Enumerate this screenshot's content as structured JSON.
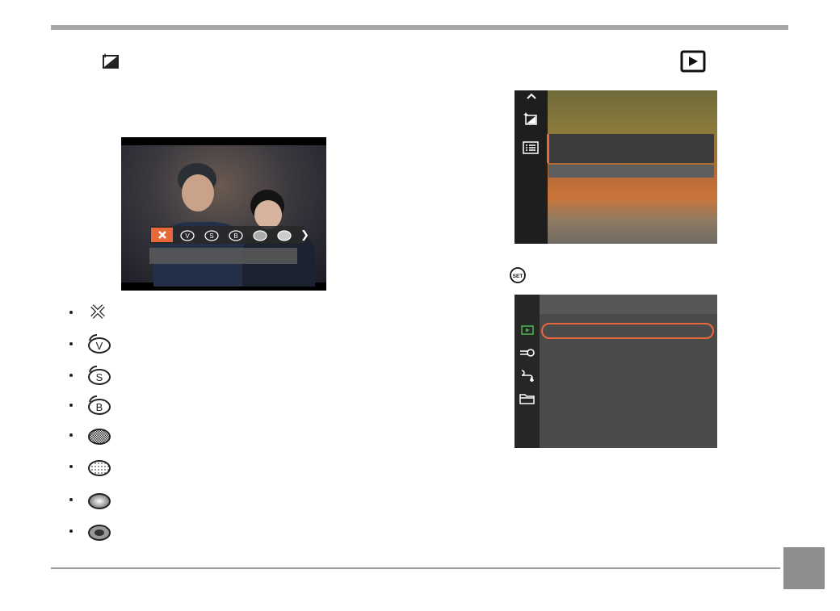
{
  "page": {
    "colors": {
      "accent": "#e8683a",
      "rule": "#a7a7a7",
      "page_tab": "#8e8e8e",
      "playback_green": "#4caf50"
    }
  },
  "headings": {
    "left_icon": "retouch-icon",
    "right_icon": "playback-icon"
  },
  "retouch_bar": {
    "effects": [
      {
        "icon": "off-x-icon",
        "selected": true
      },
      {
        "icon": "retouch-v-icon"
      },
      {
        "icon": "retouch-s-icon"
      },
      {
        "icon": "retouch-b-icon"
      },
      {
        "icon": "retouch-grid-icon"
      },
      {
        "icon": "retouch-dots-icon"
      }
    ],
    "more_icon": "chevron-right-icon"
  },
  "effect_list": [
    {
      "icon": "off-x-icon"
    },
    {
      "icon": "retouch-v-icon",
      "letter": "V"
    },
    {
      "icon": "retouch-s-icon",
      "letter": "S"
    },
    {
      "icon": "retouch-b-icon",
      "letter": "B"
    },
    {
      "icon": "retouch-checker-icon"
    },
    {
      "icon": "retouch-dots-icon"
    },
    {
      "icon": "retouch-gradient-icon"
    },
    {
      "icon": "retouch-center-icon"
    }
  ],
  "menu1": {
    "side_icons": [
      "chevron-up-icon",
      "retouch-icon",
      "list-icon"
    ]
  },
  "set_button": {
    "icon": "set-button-icon",
    "text": "SET"
  },
  "menu2": {
    "side_icons": [
      "playback-icon",
      "wrench-icon",
      "connection-icon",
      "folder-icon"
    ]
  }
}
